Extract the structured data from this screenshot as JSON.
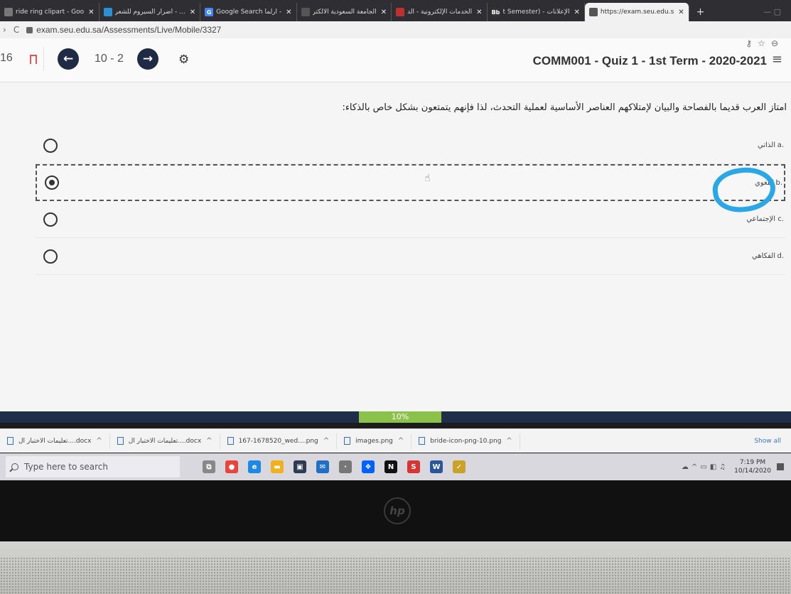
{
  "browser": {
    "tabs": [
      {
        "title": "ride ring clipart - Goo",
        "fav_color": "#777777",
        "fav_glyph": ""
      },
      {
        "title": "أضرار السيروم للشعر - ...",
        "fav_color": "#2b8fd6",
        "fav_glyph": ""
      },
      {
        "title": "Google Search ارلما -",
        "fav_color": "#4285f4",
        "fav_glyph": "G"
      },
      {
        "title": "الجامعة السعودية الالكتر",
        "fav_color": "#555555",
        "fav_glyph": ""
      },
      {
        "title": "الخدمات الإلكترونية - الد",
        "fav_color": "#c03030",
        "fav_glyph": ""
      },
      {
        "title": "t Semester) - الإعلانات",
        "fav_color": "#333333",
        "fav_glyph": "Bb"
      },
      {
        "title": "https://exam.seu.edu.s",
        "fav_color": "#555555",
        "fav_glyph": ""
      }
    ],
    "active_tab_index": 6,
    "new_tab": "+",
    "url": "exam.seu.edu.sa/Assessments/Live/Mobile/3327"
  },
  "quiz": {
    "left_number": "16",
    "pager": "10 - 2",
    "title": "COMM001 - Quiz 1 - 1st Term - 2020-2021",
    "question": "امتاز العرب قديما بالفصاحة والبيان لإمتلاكهم العناصر الأساسية لعملية التحدث، لذا فإنهم يتمتعون بشكل خاص بالذكاء:",
    "options": [
      {
        "letter": "a.",
        "text": "الذاتي",
        "selected": false
      },
      {
        "letter": "b.",
        "text": "اللغوي",
        "selected": true
      },
      {
        "letter": "c.",
        "text": "الإجتماعي",
        "selected": false
      },
      {
        "letter": "d.",
        "text": "الفكاهي",
        "selected": false
      }
    ]
  },
  "progress": {
    "label": "10%",
    "value": 0.1,
    "color": "#8bc34a",
    "track_color": "#1d2d4a"
  },
  "downloads": {
    "items": [
      {
        "name": "تعليمات الاختبار ال....docx"
      },
      {
        "name": "تعليمات الاختبار ال....docx"
      },
      {
        "name": "167-1678520_wed....png"
      },
      {
        "name": "images.png"
      },
      {
        "name": "bride-icon-png-10.png"
      }
    ],
    "show_all": "Show all"
  },
  "taskbar": {
    "search_placeholder": "Type here to search",
    "apps": [
      {
        "name": "task-view",
        "color": "#888888",
        "glyph": "⧉"
      },
      {
        "name": "chrome",
        "color": "#e8453c",
        "glyph": "●"
      },
      {
        "name": "edge",
        "color": "#1e88e5",
        "glyph": "e"
      },
      {
        "name": "file-explorer",
        "color": "#f2b01e",
        "glyph": "▬"
      },
      {
        "name": "store",
        "color": "#2f3b52",
        "glyph": "▣"
      },
      {
        "name": "mail",
        "color": "#1f6fc5",
        "glyph": "✉"
      },
      {
        "name": "app-small",
        "color": "#777777",
        "glyph": "·"
      },
      {
        "name": "dropbox",
        "color": "#0061fe",
        "glyph": "❖"
      },
      {
        "name": "netflix",
        "color": "#111111",
        "glyph": "N"
      },
      {
        "name": "app-red",
        "color": "#d83434",
        "glyph": "S"
      },
      {
        "name": "word",
        "color": "#2b579a",
        "glyph": "W"
      },
      {
        "name": "app-check",
        "color": "#c9a227",
        "glyph": "✓"
      }
    ],
    "time": "7:19 PM",
    "date": "10/14/2020"
  }
}
